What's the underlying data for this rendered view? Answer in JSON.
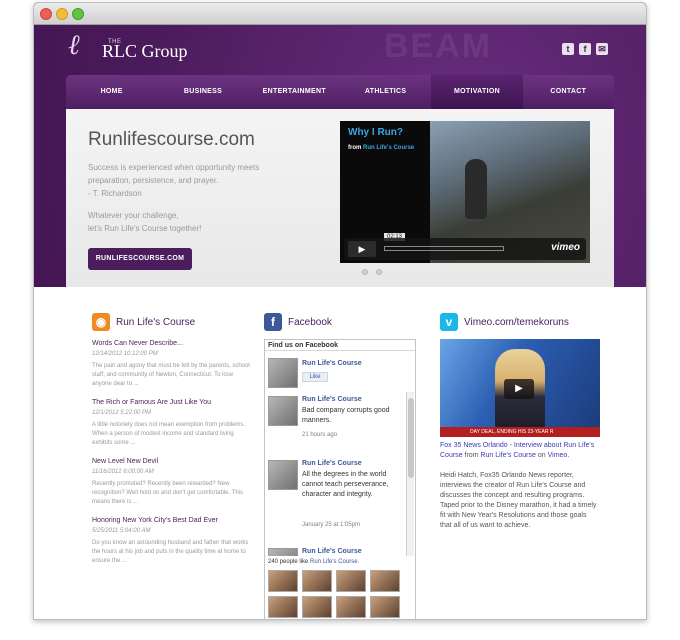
{
  "header": {
    "logo_the": "THE",
    "logo_text": "RLC Group",
    "watermark": "BEAM",
    "social": [
      {
        "icon": "twitter-icon",
        "glyph": "t"
      },
      {
        "icon": "facebook-icon",
        "glyph": "f"
      },
      {
        "icon": "email-icon",
        "glyph": "✉"
      }
    ]
  },
  "nav": {
    "items": [
      "HOME",
      "BUSINESS",
      "ENTERTAINMENT",
      "ATHLETICS",
      "MOTIVATION",
      "CONTACT"
    ],
    "active": "MOTIVATION"
  },
  "hero": {
    "title": "Runlifescourse.com",
    "quote": "Success is experienced when opportunity meets preparation, persistence, and prayer.",
    "quote_author": "- T. Richardson",
    "sub_line1": "Whatever your challenge,",
    "sub_line2": "let's Run Life's Course together!",
    "button_label": "RUNLIFESCOURSE.COM",
    "video": {
      "title": "Why I Run?",
      "from_label": "from",
      "from_channel": "Run Life's Course",
      "time": "02:13",
      "player_brand": "vimeo"
    }
  },
  "blog": {
    "heading": "Run Life's Course",
    "posts": [
      {
        "title": "Words Can Never Describe...",
        "date": "12/14/2012 10:12:00 PM",
        "excerpt": "The pain and agony that must be felt by the parents, school staff, and community of Newton, Connecticut. To lose anyone dear to ..."
      },
      {
        "title": "The Rich or Famous Are Just Like You",
        "date": "12/1/2012 5:22:00 PM",
        "excerpt": "A little notoriety does not mean exemption from problems.  When a person of modest income and standard living exhibits some ..."
      },
      {
        "title": "New Level New Devil",
        "date": "11/16/2012 6:00:00 AM",
        "excerpt": "Recently promoted?  Recently been rewarded?  New recognition?  Well hold on and don't get comfortable.  This means there is ..."
      },
      {
        "title": "Honoring New York City's Best Dad Ever",
        "date": "5/25/2011 5:04:00 AM",
        "excerpt": "Do you know an astounding husband and father that works the hours at his job and puts in the quality time at home to ensure the ..."
      }
    ]
  },
  "facebook": {
    "heading": "Facebook",
    "box_title": "Find us on Facebook",
    "page_name": "Run Life's Course",
    "like_label": "Like",
    "posts": [
      {
        "name": "Run Life's Course",
        "text": "Bad company corrupts good manners.",
        "time": "21 hours ago"
      },
      {
        "name": "Run Life's Course",
        "text": "All the degrees in the world cannot teach perseverance, character and integrity.",
        "time": "January 25 at 1:05pm"
      },
      {
        "name": "Run Life's Course",
        "text": "",
        "time": ""
      }
    ],
    "likes_count": "240 people like",
    "likes_page": "Run Life's Course."
  },
  "vimeo": {
    "heading": "Vimeo.com/temekoruns",
    "ticker": "DAY DEAL, ENDING HIS 23-YEAR R",
    "caption_link": "Fox 35 News Orlando - Interview about Run Life's Course",
    "caption_from": "from",
    "caption_channel": "Run Life's Course",
    "caption_on": "on",
    "caption_site": "Vimeo.",
    "description": "Heidi Hatch, Fox35 Orlando News reporter, interviews the creator of Run Life's Course and discusses the concept and resulting programs. Taped prior to the Disney marathon, it had a timely fit with New Year's Resolutions and those goals that all of us want to achieve."
  }
}
